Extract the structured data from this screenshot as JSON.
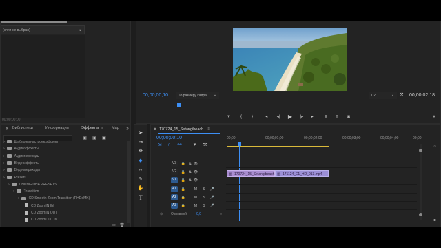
{
  "source_panel": {
    "clip_placeholder": "(клип не выбран)",
    "timecode": "00;00;00;00"
  },
  "program_monitor": {
    "timecode": "00;00;00;10",
    "fit_label": "По размеру кадра",
    "resolution": "1/2",
    "duration": "00;00;02;18"
  },
  "project_panel": {
    "tabs": [
      "Библиотеки",
      "Информация",
      "Эффекты",
      "Мар"
    ],
    "active_tab": "Эффекты",
    "items": [
      {
        "label": "Шаблоны настроек эффект",
        "indent": 0,
        "type": "folder"
      },
      {
        "label": "Аудиоэффекты",
        "indent": 0,
        "type": "folder"
      },
      {
        "label": "Аудиопереходы",
        "indent": 0,
        "type": "folder"
      },
      {
        "label": "Видеоэффекты",
        "indent": 0,
        "type": "folder"
      },
      {
        "label": "Видеопереходы",
        "indent": 0,
        "type": "folder"
      },
      {
        "label": "Presets",
        "indent": 0,
        "type": "folder"
      },
      {
        "label": "CHUNG DHA PRESETS",
        "indent": 1,
        "type": "folder"
      },
      {
        "label": "Transition",
        "indent": 2,
        "type": "folder"
      },
      {
        "label": "CD Smooth Zoom Transition (PHDdMK)",
        "indent": 3,
        "type": "folder"
      },
      {
        "label": "CD ZoomIN IN",
        "indent": 4,
        "type": "preset"
      },
      {
        "label": "CD ZoomIN OUT",
        "indent": 4,
        "type": "preset"
      },
      {
        "label": "CD ZoomOUT IN",
        "indent": 4,
        "type": "preset"
      },
      {
        "label": "CD ZoomOUT OUT",
        "indent": 4,
        "type": "preset"
      }
    ]
  },
  "timeline": {
    "sequence_tab": "170724_15_Setangibeach",
    "timecode": "00;00;00;10",
    "ruler": [
      "00;00",
      "00;00;01;00",
      "00;00;02;00",
      "00;00;03;00",
      "00;00;04;00",
      "00;00"
    ],
    "tracks": [
      {
        "name": "V3"
      },
      {
        "name": "V2"
      },
      {
        "name": "V1"
      },
      {
        "name": "A1"
      },
      {
        "name": "A2"
      },
      {
        "name": "A3"
      }
    ],
    "mix_label": "Основной",
    "mix_value": "0,0",
    "clips": [
      {
        "label": "170724_15_Setangibeach",
        "color": "#a98dd0"
      },
      {
        "label": "171124_E1_HD_013.mp4",
        "color": "#9b8fd6"
      }
    ]
  },
  "colors": {
    "accent": "#3d8ff5",
    "clip_purple": "#a98dd0",
    "work_area": "#d9b93a"
  }
}
